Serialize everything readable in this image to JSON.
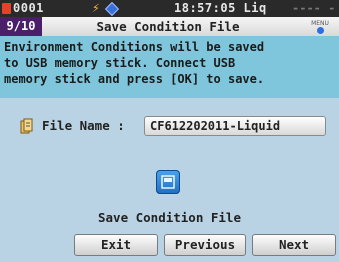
{
  "status_bar": {
    "record_number": "0001",
    "time": "18:57:05",
    "mode": "Liq",
    "placeholder": "---- ----"
  },
  "title_bar": {
    "step": "9/10",
    "title": "Save Condition File",
    "menu_icon_label": "MENU"
  },
  "message": {
    "lines": [
      "Environment Conditions will be saved",
      "to USB memory stick. Connect USB",
      "memory stick and press [OK] to save."
    ]
  },
  "file": {
    "label": "File Name :",
    "value": "CF612202011-Liquid"
  },
  "save_label": "Save Condition File",
  "buttons": {
    "exit": "Exit",
    "previous": "Previous",
    "next": "Next"
  },
  "colors": {
    "background": "#b9d3e4",
    "message_bg": "#7fc6dc",
    "step_bg": "#4a1e68",
    "record_indicator": "#e8402a",
    "save_icon": "#2f8ad8"
  },
  "icons": [
    "record-indicator-icon",
    "power-bolt-icon",
    "usb-diamond-icon",
    "menu-icon",
    "file-icon",
    "save-icon"
  ]
}
